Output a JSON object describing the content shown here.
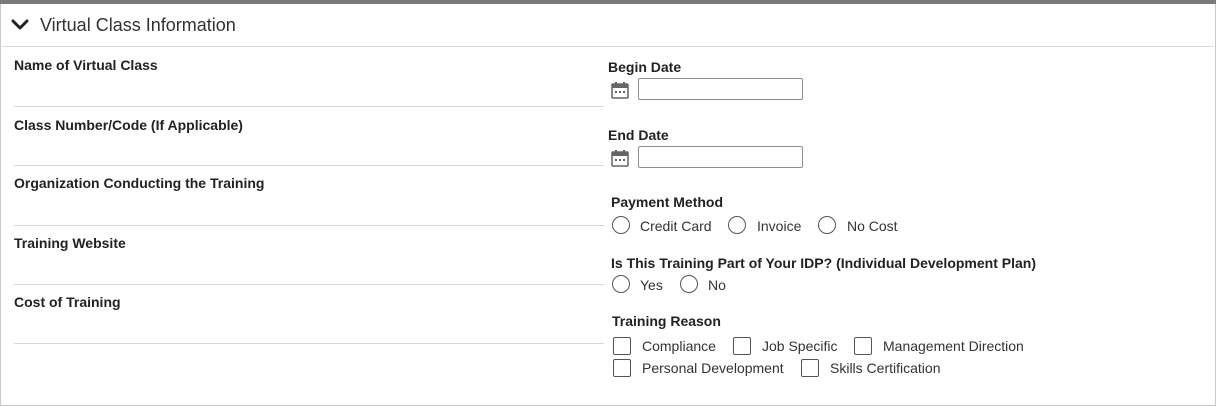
{
  "section": {
    "title": "Virtual Class Information",
    "toggle_icon": "chevron-down-icon"
  },
  "left_fields": [
    {
      "label": "Name of Virtual Class"
    },
    {
      "label": "Class Number/Code (If Applicable)"
    },
    {
      "label": "Organization Conducting the Training"
    },
    {
      "label": "Training Website"
    },
    {
      "label": "Cost of Training"
    }
  ],
  "begin_date": {
    "label": "Begin Date",
    "value": "",
    "icon": "calendar-icon"
  },
  "end_date": {
    "label": "End Date",
    "value": "",
    "icon": "calendar-icon"
  },
  "payment_method": {
    "label": "Payment Method",
    "options": [
      "Credit Card",
      "Invoice",
      "No Cost"
    ]
  },
  "idp": {
    "label": "Is This Training Part of Your IDP? (Individual Development Plan)",
    "options": [
      "Yes",
      "No"
    ]
  },
  "training_reason": {
    "label": "Training Reason",
    "options": [
      "Compliance",
      "Job Specific",
      "Management Direction",
      "Personal Development",
      "Skills Certification"
    ]
  }
}
